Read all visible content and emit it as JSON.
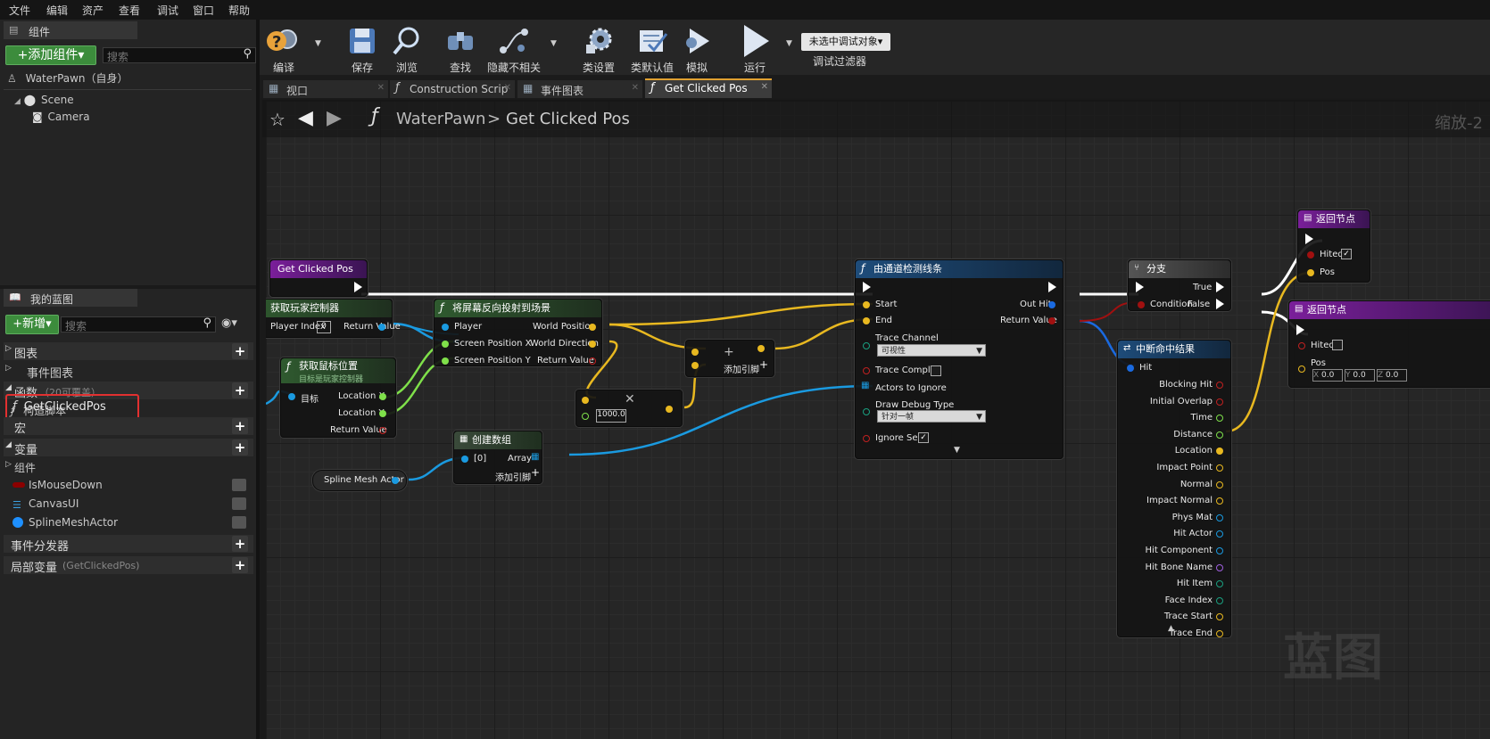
{
  "menu": [
    "文件",
    "编辑",
    "资产",
    "查看",
    "调试",
    "窗口",
    "帮助"
  ],
  "components_panel": {
    "tab": "组件",
    "add_button": "+添加组件▾",
    "search_placeholder": "搜索",
    "root": "WaterPawn（自身）",
    "tree": [
      "Scene",
      "Camera"
    ]
  },
  "my_blueprint": {
    "tab": "我的蓝图",
    "new_button": "+新增▾",
    "search_placeholder": "搜索",
    "sections": {
      "graphs": "图表",
      "event_graph": "事件图表",
      "functions": "函数",
      "functions_note": "（20可覆盖）",
      "construction": "构造脚本",
      "selected_function": "GetClickedPos",
      "macros": "宏",
      "variables": "变量",
      "components": "组件",
      "dispatchers": "事件分发器",
      "local_vars": "局部变量",
      "local_vars_note": "(GetClickedPos)"
    },
    "vars": [
      "IsMouseDown",
      "CanvasUI",
      "SplineMeshActor"
    ]
  },
  "toolbar": {
    "compile": "编译",
    "save": "保存",
    "browse": "浏览",
    "find": "查找",
    "hide_unrelated": "隐藏不相关",
    "class_settings": "类设置",
    "class_defaults": "类默认值",
    "simulate": "模拟",
    "run": "运行",
    "debug_target": "未选中调试对象▾",
    "debug_filter": "调试过滤器"
  },
  "tabs": [
    "视口",
    "Construction Scrip",
    "事件图表",
    "Get Clicked Pos"
  ],
  "breadcrumb": {
    "root": "WaterPawn",
    "sep": ">",
    "current": "Get Clicked Pos"
  },
  "zoom": "缩放-2",
  "watermark": "蓝图",
  "nodes": {
    "entry": "Get Clicked Pos",
    "get_pc": {
      "title": "获取玩家控制器",
      "player_index": "Player Index",
      "player_index_val": "0",
      "return": "Return Value"
    },
    "mouse": {
      "title": "获取鼠标位置",
      "sub": "目标是玩家控制器",
      "target": "目标",
      "lx": "Location X",
      "ly": "Location Y",
      "ret": "Return Value"
    },
    "deproject": {
      "title": "将屏幕反向投射到场景",
      "player": "Player",
      "sx": "Screen Position X",
      "sy": "Screen Position Y",
      "wp": "World Position",
      "wd": "World Direction",
      "ret": "Return Value"
    },
    "multiply": {
      "val": "1000.0"
    },
    "add": {
      "add_pin": "添加引脚"
    },
    "make_array": {
      "title": "创建数组",
      "idx": "[0]",
      "array": "Array",
      "add_pin": "添加引脚"
    },
    "spline_var": "Spline Mesh Actor",
    "trace": {
      "title": "由通道检测线条",
      "start": "Start",
      "end": "End",
      "out_hit": "Out Hit",
      "ret": "Return Value",
      "channel": "Trace Channel",
      "channel_val": "可视性",
      "complex": "Trace Complex",
      "ignore": "Actors to Ignore",
      "debug": "Draw Debug Type",
      "debug_val": "针对一帧",
      "self": "Ignore Self"
    },
    "branch": {
      "title": "分支",
      "cond": "Condition",
      "t": "True",
      "f": "False"
    },
    "break_hit": {
      "title": "中断命中结果",
      "hit": "Hit",
      "outs": [
        "Blocking Hit",
        "Initial Overlap",
        "Time",
        "Distance",
        "Location",
        "Impact Point",
        "Normal",
        "Impact Normal",
        "Phys Mat",
        "Hit Actor",
        "Hit Component",
        "Hit Bone Name",
        "Hit Item",
        "Face Index",
        "Trace Start",
        "Trace End"
      ]
    },
    "return1": {
      "title": "返回节点",
      "hited": "Hited",
      "pos": "Pos"
    },
    "return2": {
      "title": "返回节点",
      "hited": "Hited",
      "pos": "Pos",
      "x": "X",
      "xv": "0.0",
      "y": "Y",
      "yv": "0.0",
      "z": "Z",
      "zv": "0.0"
    }
  }
}
